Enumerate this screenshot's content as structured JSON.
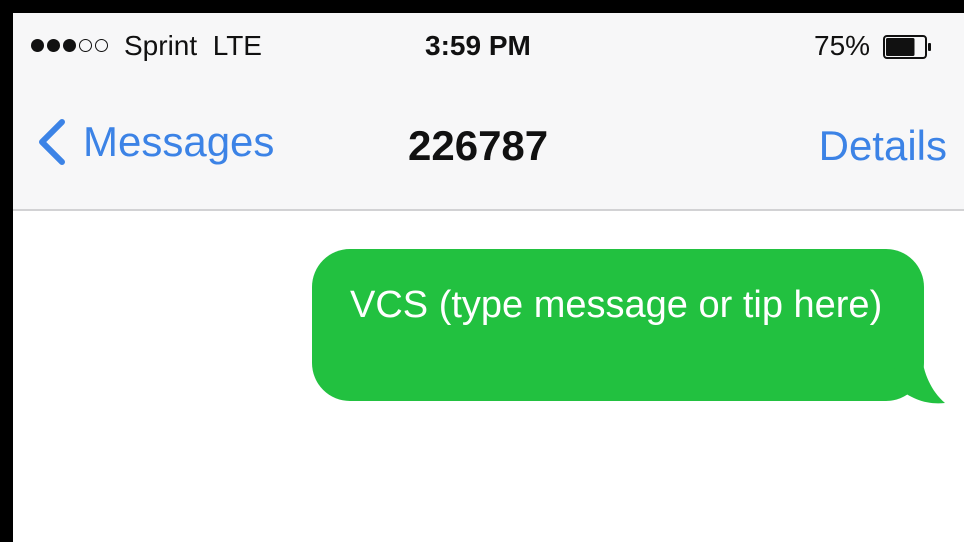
{
  "status_bar": {
    "signal": [
      1,
      1,
      1,
      0,
      0
    ],
    "carrier": "Sprint  LTE",
    "time": "3:59 PM",
    "battery_percent": "75%",
    "battery_level": 0.75
  },
  "nav_bar": {
    "back_label": "Messages",
    "back_icon": "chevron-left-icon",
    "title": "226787",
    "details_label": "Details"
  },
  "conversation": {
    "messages": [
      {
        "direction": "sent",
        "text": "VCS (type message or tip here)"
      }
    ]
  },
  "colors": {
    "accent": "#3c83e6",
    "bubble_sent": "#22c140",
    "nav_background": "#f7f7f8",
    "text": "#111111"
  }
}
